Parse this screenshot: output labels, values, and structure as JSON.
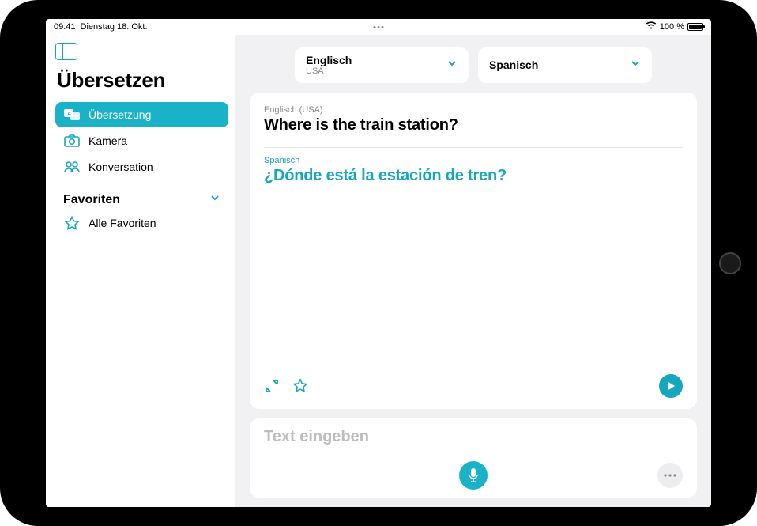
{
  "status": {
    "time": "09:41",
    "date": "Dienstag 18. Okt.",
    "battery_text": "100 %"
  },
  "sidebar": {
    "app_title": "Übersetzen",
    "items": [
      {
        "label": "Übersetzung",
        "icon": "translate-icon",
        "active": true
      },
      {
        "label": "Kamera",
        "icon": "camera-icon",
        "active": false
      },
      {
        "label": "Konversation",
        "icon": "conversation-icon",
        "active": false
      }
    ],
    "favorites_header": "Favoriten",
    "favorites_items": [
      {
        "label": "Alle Favoriten",
        "icon": "star-icon"
      }
    ]
  },
  "languages": {
    "source": {
      "name": "Englisch",
      "sub": "USA"
    },
    "target": {
      "name": "Spanisch",
      "sub": ""
    }
  },
  "translation": {
    "source_lang_label": "Englisch (USA)",
    "source_text": "Where is the train station?",
    "target_lang_label": "Spanisch",
    "target_text": "¿Dónde está la estación de tren?"
  },
  "input": {
    "placeholder": "Text eingeben"
  },
  "colors": {
    "accent": "#17a7bd",
    "accent_fill": "#1ab2c7"
  }
}
